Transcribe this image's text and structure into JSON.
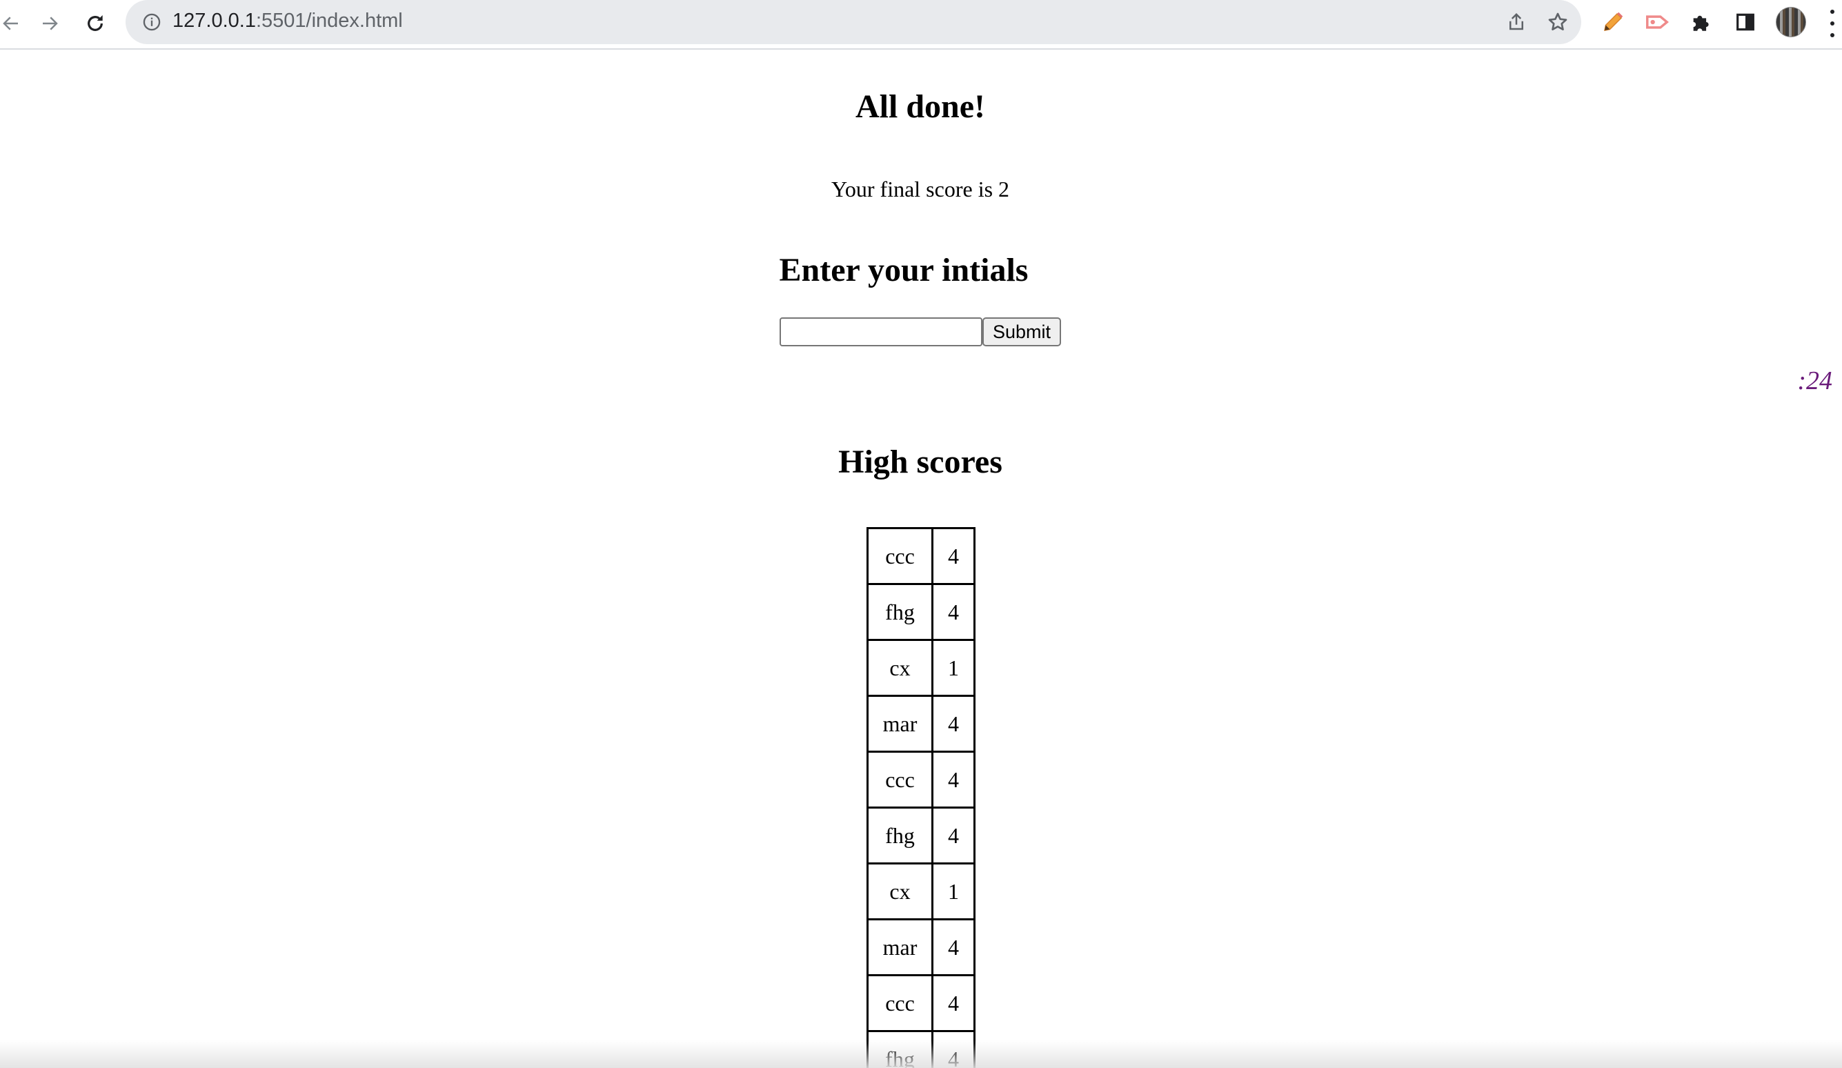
{
  "browser": {
    "url_host": "127.0.0.1",
    "url_path": ":5501/index.html",
    "icons": {
      "back": "arrow-left-icon",
      "forward": "arrow-right-icon",
      "reload": "reload-icon",
      "site_info": "info-icon",
      "share": "share-icon",
      "bookmark": "star-icon",
      "ext1": "pencil-icon",
      "ext2": "tag-arrow-icon",
      "extensions": "puzzle-icon",
      "sidepanel": "side-panel-icon",
      "profile": "avatar",
      "menu": "kebab-menu-icon"
    }
  },
  "quiz": {
    "done_heading": "All done!",
    "final_score_text": "Your final score is 2",
    "initials_heading": "Enter your intials",
    "initials_value": "",
    "submit_label": "Submit",
    "timer_text": ":24",
    "timer_color": "#6a1b7a"
  },
  "high_scores": {
    "heading": "High scores",
    "rows": [
      {
        "name": "ccc",
        "score": "4"
      },
      {
        "name": "fhg",
        "score": "4"
      },
      {
        "name": "cx",
        "score": "1"
      },
      {
        "name": "mar",
        "score": "4"
      },
      {
        "name": "ccc",
        "score": "4"
      },
      {
        "name": "fhg",
        "score": "4"
      },
      {
        "name": "cx",
        "score": "1"
      },
      {
        "name": "mar",
        "score": "4"
      },
      {
        "name": "ccc",
        "score": "4"
      },
      {
        "name": "fhg",
        "score": "4"
      }
    ]
  }
}
